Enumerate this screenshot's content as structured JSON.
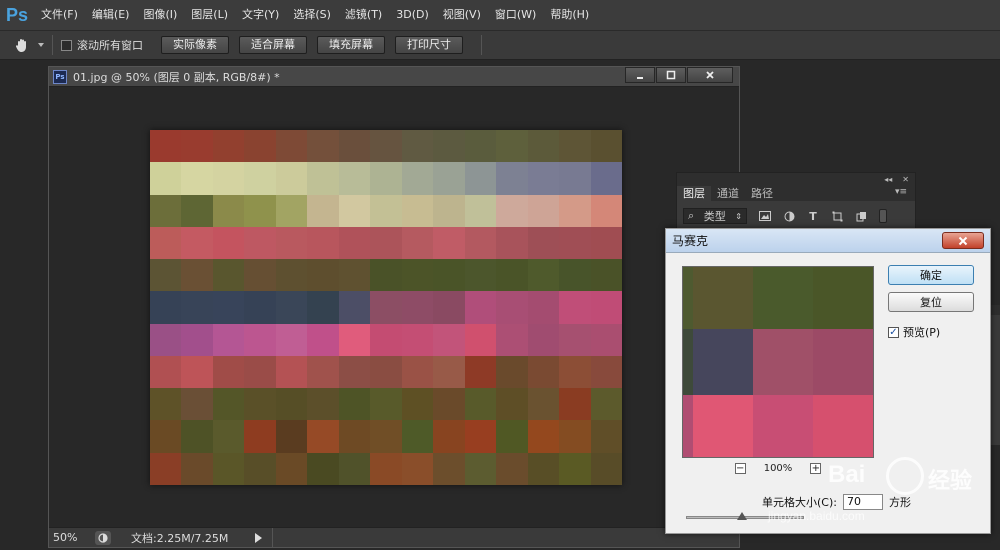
{
  "app": {
    "logo": "Ps",
    "menu": [
      "文件(F)",
      "编辑(E)",
      "图像(I)",
      "图层(L)",
      "文字(Y)",
      "选择(S)",
      "滤镜(T)",
      "3D(D)",
      "视图(V)",
      "窗口(W)",
      "帮助(H)"
    ]
  },
  "options": {
    "scroll_all_label": "滚动所有窗口",
    "buttons": [
      "实际像素",
      "适合屏幕",
      "填充屏幕",
      "打印尺寸"
    ]
  },
  "document": {
    "title": "01.jpg @ 50% (图层 0 副本, RGB/8#) *",
    "zoom": "50%",
    "doc_size": "文档:2.25M/7.25M",
    "mosaic_colors": [
      [
        "#9a3a2e",
        "#993c2f",
        "#92402f",
        "#8a4330",
        "#7e4a36",
        "#74503b",
        "#6a4f3c",
        "#665440",
        "#605a42",
        "#5c5a40",
        "#5a5c3d",
        "#5e603c",
        "#5c5a3a",
        "#5e5536",
        "#5a5030"
      ],
      [
        "#cfd19a",
        "#d6d6a2",
        "#d4d3a1",
        "#cfd1a0",
        "#cccb9b",
        "#bfc196",
        "#b8bc98",
        "#adb393",
        "#a2a995",
        "#9aa295",
        "#8d9595",
        "#7d8193",
        "#7a7c94",
        "#787a92",
        "#6a6c8c"
      ],
      [
        "#6c6e3a",
        "#5e6634",
        "#8b8a4a",
        "#8f924c",
        "#a2a463",
        "#c4b590",
        "#d2c8a0",
        "#c3c095",
        "#c7bc92",
        "#bdb48e",
        "#c0c099",
        "#cea99b",
        "#cea496",
        "#d49a88",
        "#d48778"
      ],
      [
        "#bc5c5a",
        "#c45a62",
        "#c4545f",
        "#be5862",
        "#b9595f",
        "#b8565d",
        "#b0525a",
        "#ac545a",
        "#b55a60",
        "#c05c66",
        "#b35960",
        "#a8535b",
        "#9e4f56",
        "#a04e55",
        "#a04d52"
      ],
      [
        "#5c5434",
        "#6a5034",
        "#59562e",
        "#664f33",
        "#5e5030",
        "#5e4e2e",
        "#5f5130",
        "#4a5228",
        "#4c5428",
        "#4a5428",
        "#4c562c",
        "#4a5428",
        "#4f5a2c",
        "#48542a",
        "#4a5228"
      ],
      [
        "#364256",
        "#384458",
        "#38445a",
        "#364256",
        "#3a4658",
        "#344250",
        "#4c4e66",
        "#8c4e64",
        "#8e4c66",
        "#8a4a62",
        "#b04e7a",
        "#a84e74",
        "#a44c70",
        "#c04e78",
        "#c04c76"
      ],
      [
        "#9a5086",
        "#a24f8c",
        "#b45694",
        "#bc5690",
        "#c05e94",
        "#c0508a",
        "#e05c7c",
        "#c44c72",
        "#c44e74",
        "#c2547a",
        "#d0506e",
        "#ac4f74",
        "#a04c70",
        "#a65070",
        "#aa4e70"
      ],
      [
        "#b05052",
        "#be5458",
        "#a04c48",
        "#9a4c48",
        "#b45254",
        "#a0524c",
        "#8c4e46",
        "#8a4d42",
        "#9a5246",
        "#985a48",
        "#8e3a26",
        "#6a4a2c",
        "#7a4a32",
        "#8c4e36",
        "#884a3c"
      ],
      [
        "#5e5228",
        "#6a4f36",
        "#545628",
        "#5a5028",
        "#564e26",
        "#5c4f2a",
        "#4e5426",
        "#585a2a",
        "#5e5024",
        "#6a4a2a",
        "#585a2a",
        "#5e4e26",
        "#6a5230",
        "#8a3c22",
        "#5c5a2c"
      ],
      [
        "#6a4a24",
        "#4e5226",
        "#5a5a2c",
        "#8e3c20",
        "#5a3c20",
        "#964a26",
        "#6e4a24",
        "#704e26",
        "#4e5a28",
        "#884420",
        "#983e20",
        "#505824",
        "#94481e",
        "#844c22",
        "#604e28"
      ],
      [
        "#8a3e26",
        "#6a4a2a",
        "#5a5628",
        "#584e28",
        "#6a4a26",
        "#4a4a22",
        "#50522a",
        "#8a4a26",
        "#8a4e2a",
        "#6c4e2c",
        "#5c5c30",
        "#6a4c2c",
        "#584e26",
        "#5a5a24",
        "#584c28"
      ]
    ]
  },
  "layers_panel": {
    "tabs": [
      "图层",
      "通道",
      "路径"
    ],
    "filter_label": "类型"
  },
  "dialog": {
    "title": "马赛克",
    "ok": "确定",
    "reset": "复位",
    "preview_label": "预览(P)",
    "preview_checked": true,
    "zoom_text": "100%",
    "cell_label": "单元格大小(C):",
    "cell_value": "70",
    "cell_unit": "方形",
    "preview_colors": [
      [
        "#4e5a30",
        "#5a5630",
        "#4a5a2c",
        "#4a5628"
      ],
      [
        "#3e4a3a",
        "#46465c",
        "#a05068",
        "#9c4a66"
      ],
      [
        "#b04d72",
        "#e05774",
        "#c84e74",
        "#d6506e"
      ]
    ]
  },
  "watermark": {
    "logo_text": "Bai",
    "jy": "经验",
    "url": "jingyan.baidu.com"
  }
}
